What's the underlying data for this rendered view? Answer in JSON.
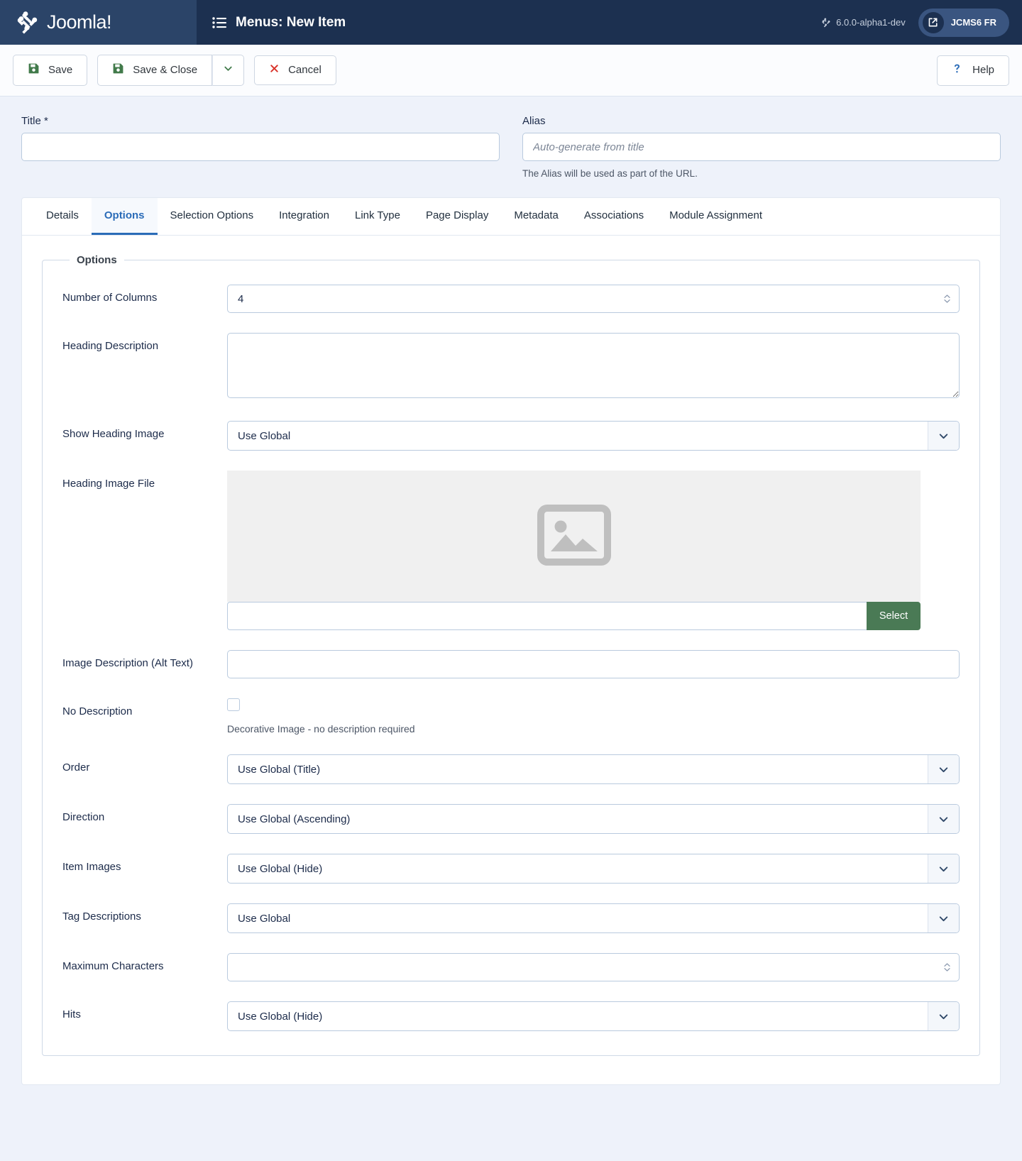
{
  "topbar": {
    "brand_name": "Joomla!",
    "page_title": "Menus: New Item",
    "version": "6.0.0-alpha1-dev",
    "user_label": "JCMS6 FR"
  },
  "toolbar": {
    "save_label": "Save",
    "save_close_label": "Save & Close",
    "cancel_label": "Cancel",
    "help_label": "Help"
  },
  "form_head": {
    "title_label": "Title *",
    "title_value": "",
    "alias_label": "Alias",
    "alias_placeholder": "Auto-generate from title",
    "alias_help": "The Alias will be used as part of the URL."
  },
  "tabs": [
    {
      "label": "Details",
      "active": false
    },
    {
      "label": "Options",
      "active": true
    },
    {
      "label": "Selection Options",
      "active": false
    },
    {
      "label": "Integration",
      "active": false
    },
    {
      "label": "Link Type",
      "active": false
    },
    {
      "label": "Page Display",
      "active": false
    },
    {
      "label": "Metadata",
      "active": false
    },
    {
      "label": "Associations",
      "active": false
    },
    {
      "label": "Module Assignment",
      "active": false
    }
  ],
  "options_panel": {
    "legend": "Options",
    "number_of_columns": {
      "label": "Number of Columns",
      "value": "4"
    },
    "heading_description": {
      "label": "Heading Description",
      "value": ""
    },
    "show_heading_image": {
      "label": "Show Heading Image",
      "value": "Use Global"
    },
    "heading_image_file": {
      "label": "Heading Image File",
      "value": "",
      "select_label": "Select",
      "placeholder_icon": "image-placeholder-icon"
    },
    "image_description": {
      "label": "Image Description (Alt Text)",
      "value": ""
    },
    "no_description": {
      "label": "No Description",
      "checked": false,
      "help": "Decorative Image - no description required"
    },
    "order": {
      "label": "Order",
      "value": "Use Global (Title)"
    },
    "direction": {
      "label": "Direction",
      "value": "Use Global (Ascending)"
    },
    "item_images": {
      "label": "Item Images",
      "value": "Use Global (Hide)"
    },
    "tag_descriptions": {
      "label": "Tag Descriptions",
      "value": "Use Global"
    },
    "maximum_characters": {
      "label": "Maximum Characters",
      "value": ""
    },
    "hits": {
      "label": "Hits",
      "value": "Use Global (Hide)"
    }
  },
  "colors": {
    "topbar": "#1c3050",
    "brand_panel": "#2b4468",
    "accent_blue": "#2b6cb8",
    "save_green": "#4a7a55",
    "cancel_red": "#d9342b",
    "page_bg": "#eef2fa"
  }
}
